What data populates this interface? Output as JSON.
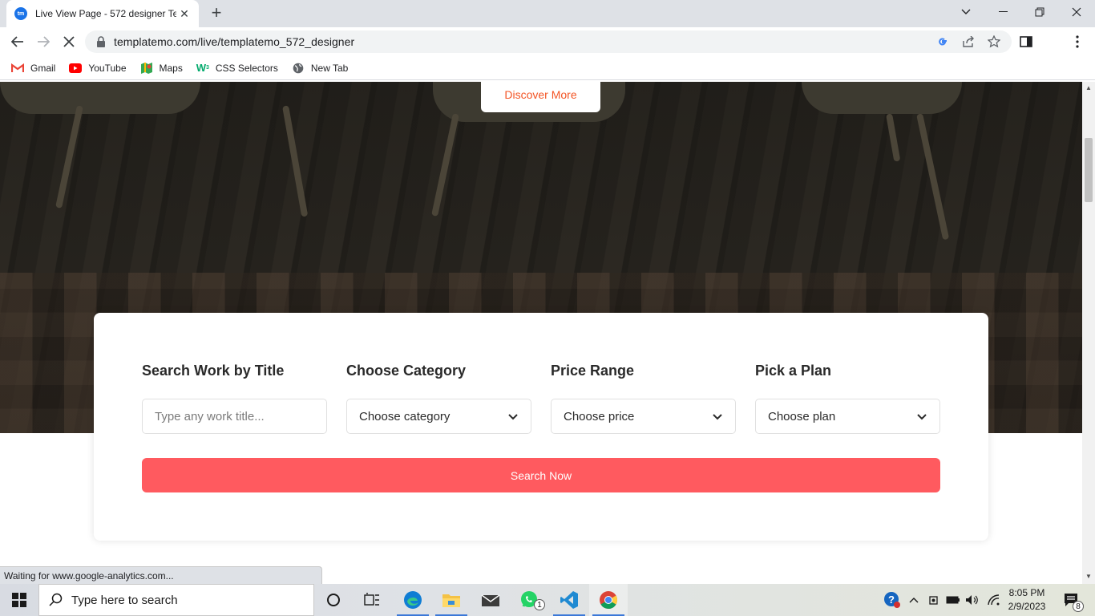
{
  "browser": {
    "tab_title": "Live View Page - 572 designer Te",
    "favicon_text": "tm",
    "url": "templatemo.com/live/templatemo_572_designer",
    "bookmarks": [
      {
        "label": "Gmail",
        "icon": "gmail-icon"
      },
      {
        "label": "YouTube",
        "icon": "youtube-icon"
      },
      {
        "label": "Maps",
        "icon": "maps-icon"
      },
      {
        "label": "CSS Selectors",
        "icon": "w3schools-icon"
      },
      {
        "label": "New Tab",
        "icon": "globe-icon"
      }
    ],
    "status_text": "Waiting for www.google-analytics.com..."
  },
  "page": {
    "discover_label": "Discover More",
    "search": {
      "title_label": "Search Work by Title",
      "title_placeholder": "Type any work title...",
      "category_label": "Choose Category",
      "category_value": "Choose category",
      "price_label": "Price Range",
      "price_value": "Choose price",
      "plan_label": "Pick a Plan",
      "plan_value": "Choose plan",
      "button_label": "Search Now"
    },
    "colors": {
      "accent": "#ff5a5f",
      "discover_text": "#f35525"
    }
  },
  "taskbar": {
    "search_placeholder": "Type here to search",
    "whatsapp_badge": "1",
    "time": "8:05 PM",
    "date": "2/9/2023",
    "notification_count": "8"
  }
}
